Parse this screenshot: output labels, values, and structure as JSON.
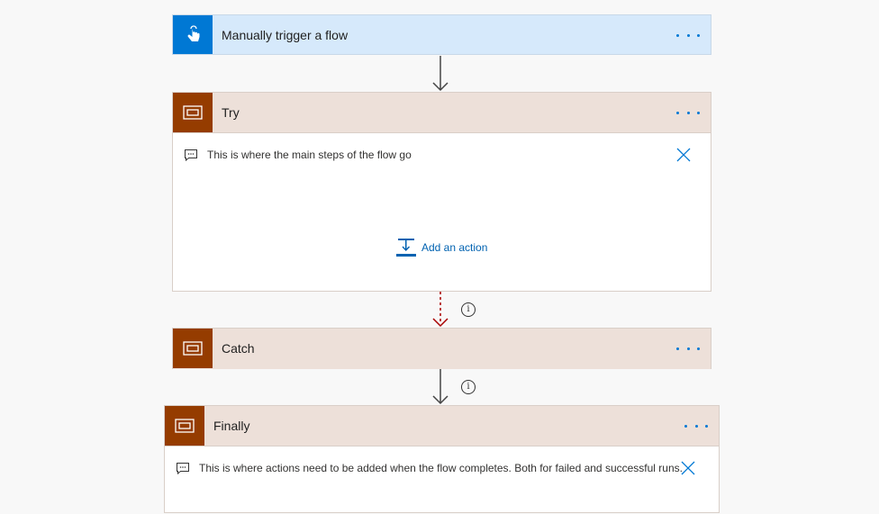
{
  "trigger": {
    "title": "Manually trigger a flow",
    "icon": "touch-hand-icon"
  },
  "try": {
    "title": "Try",
    "comment": "This is where the main steps of the flow go",
    "add_action": "Add an action"
  },
  "catch": {
    "title": "Catch"
  },
  "finally": {
    "title": "Finally",
    "comment": "This is where actions need to be added when the flow completes. Both for failed and successful runs."
  },
  "colors": {
    "trigger_accent": "#0078d4",
    "scope_accent": "#953c00",
    "link": "#0078d4",
    "error_connector": "#a80000"
  }
}
